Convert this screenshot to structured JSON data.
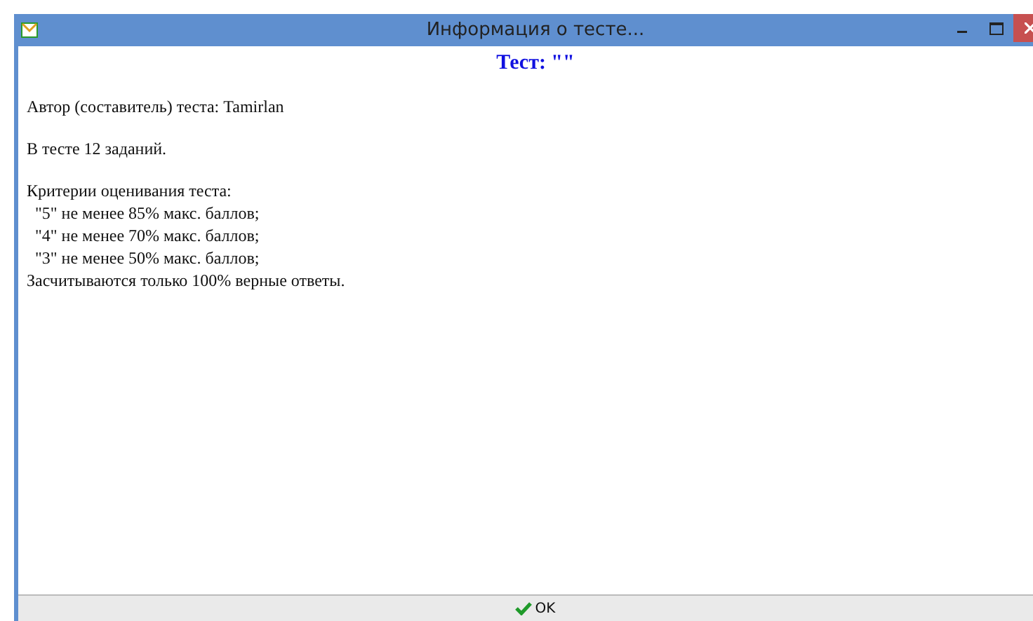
{
  "window": {
    "title": "Информация о тесте..."
  },
  "heading": "Тест: \"\"",
  "paragraphs": [
    {
      "lines": [
        {
          "kind": "plain",
          "text": "Автор (составитель) теста: Tamirlan"
        }
      ]
    },
    {
      "lines": [
        {
          "kind": "plain",
          "text": "В тесте 12 заданий."
        }
      ]
    },
    {
      "lines": [
        {
          "kind": "plain",
          "text": "Критерии оценивания теста:"
        },
        {
          "kind": "criterion",
          "text": "\"5\" не менее 85% макс. баллов;"
        },
        {
          "kind": "criterion",
          "text": "\"4\" не менее 70% макс. баллов;"
        },
        {
          "kind": "criterion",
          "text": "\"3\" не менее 50% макс. баллов;"
        },
        {
          "kind": "plain",
          "text": "Засчитываются только 100% верные ответы."
        }
      ]
    }
  ],
  "buttons": [
    {
      "label": "OK"
    }
  ]
}
